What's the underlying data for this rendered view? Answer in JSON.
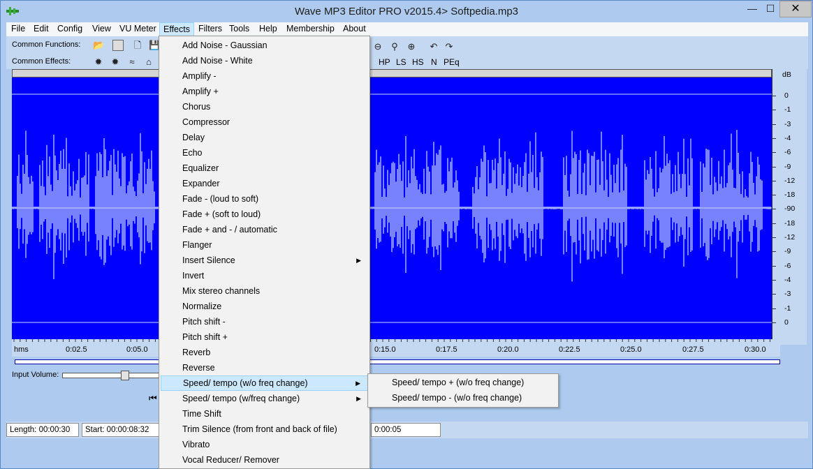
{
  "window": {
    "title": "Wave MP3 Editor PRO v2015.4> Softpedia.mp3",
    "close_glyph": "✕",
    "min_glyph": "—",
    "max_glyph": "☐"
  },
  "menubar": {
    "items": [
      "File",
      "Edit",
      "Config",
      "View",
      "VU Meter",
      "Effects",
      "Filters",
      "Tools",
      "Help",
      "Membership",
      "About"
    ],
    "active": "Effects"
  },
  "toolbar": {
    "common_functions_label": "Common Functions:",
    "common_effects_label": "Common Effects:",
    "filter_buttons": [
      "HP",
      "LS",
      "HS",
      "N",
      "PEq"
    ]
  },
  "db_scale": {
    "unit": "dB",
    "ticks": [
      "0",
      "-1",
      "-3",
      "-4",
      "-6",
      "-9",
      "-12",
      "-18",
      "-90",
      "-18",
      "-12",
      "-9",
      "-6",
      "-4",
      "-3",
      "-1",
      "0"
    ]
  },
  "time_axis": {
    "labels": [
      "hms",
      "0:02.5",
      "0:05.0",
      "0:15.0",
      "0:17.5",
      "0:20.0",
      "0:22.5",
      "0:25.0",
      "0:27.5",
      "0:30.0"
    ]
  },
  "controls": {
    "input_volume_label": "Input Volume:"
  },
  "status": {
    "length": "Length: 00:00:30",
    "start": "Start: 00:00:08:32",
    "end_fragment": "0:00:05"
  },
  "effects_menu": {
    "items": [
      {
        "label": "Add Noise - Gaussian",
        "submenu": false
      },
      {
        "label": "Add Noise - White",
        "submenu": false
      },
      {
        "label": "Amplify -",
        "submenu": false
      },
      {
        "label": "Amplify +",
        "submenu": false
      },
      {
        "label": "Chorus",
        "submenu": false
      },
      {
        "label": "Compressor",
        "submenu": false
      },
      {
        "label": "Delay",
        "submenu": false
      },
      {
        "label": "Echo",
        "submenu": false
      },
      {
        "label": "Equalizer",
        "submenu": false
      },
      {
        "label": "Expander",
        "submenu": false
      },
      {
        "label": "Fade - (loud to soft)",
        "submenu": false
      },
      {
        "label": "Fade + (soft to loud)",
        "submenu": false
      },
      {
        "label": "Fade + and - / automatic",
        "submenu": false
      },
      {
        "label": "Flanger",
        "submenu": false
      },
      {
        "label": "Insert Silence",
        "submenu": true
      },
      {
        "label": "Invert",
        "submenu": false
      },
      {
        "label": "Mix stereo channels",
        "submenu": false
      },
      {
        "label": "Normalize",
        "submenu": false
      },
      {
        "label": "Pitch shift -",
        "submenu": false
      },
      {
        "label": "Pitch shift +",
        "submenu": false
      },
      {
        "label": "Reverb",
        "submenu": false
      },
      {
        "label": "Reverse",
        "submenu": false
      },
      {
        "label": "Speed/ tempo (w/o freq change)",
        "submenu": true,
        "highlighted": true
      },
      {
        "label": "Speed/ tempo (w/freq change)",
        "submenu": true
      },
      {
        "label": "Time Shift",
        "submenu": false
      },
      {
        "label": "Trim Silence (from front and back of file)",
        "submenu": false
      },
      {
        "label": "Vibrato",
        "submenu": false
      },
      {
        "label": "Vocal Reducer/ Remover",
        "submenu": false
      }
    ],
    "submenu_items": [
      "Speed/ tempo + (w/o freq change)",
      "Speed/ tempo -  (w/o freq change)"
    ]
  },
  "colors": {
    "waveform_bg": "#0000ff",
    "waveform_fg": "#c8d8ff",
    "menu_highlight": "#cce8ff"
  }
}
